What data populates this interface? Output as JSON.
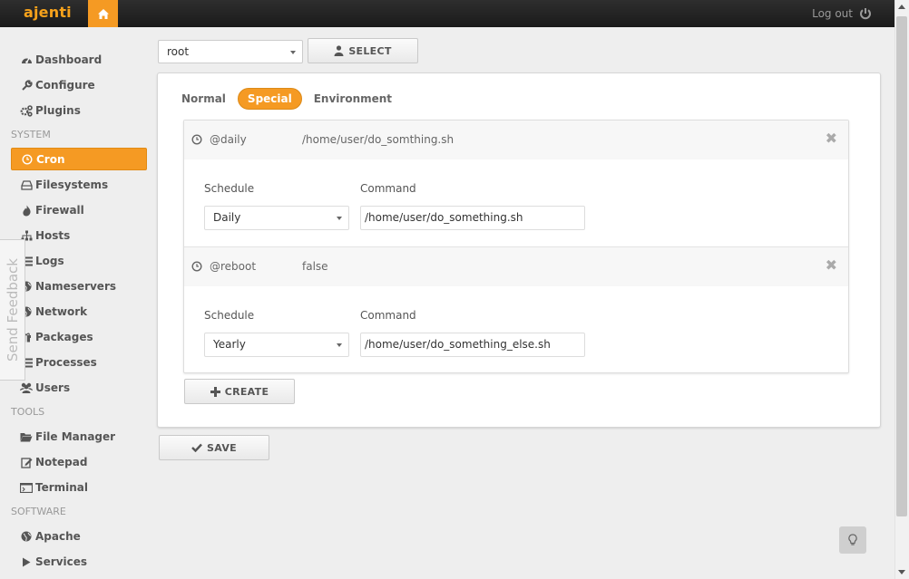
{
  "app": {
    "brand": "ajenti",
    "logout_label": "Log out"
  },
  "colors": {
    "accent": "#f59a23",
    "topbar": "#1f1f1f"
  },
  "sidebar": {
    "items_top": [
      {
        "label": "Dashboard",
        "icon": "dashboard-icon"
      },
      {
        "label": "Configure",
        "icon": "wrench-icon"
      },
      {
        "label": "Plugins",
        "icon": "cogs-icon"
      }
    ],
    "system_label": "SYSTEM",
    "items_system": [
      {
        "label": "Cron",
        "icon": "clock-icon",
        "active": true
      },
      {
        "label": "Filesystems",
        "icon": "hdd-icon"
      },
      {
        "label": "Firewall",
        "icon": "fire-icon"
      },
      {
        "label": "Hosts",
        "icon": "sitemap-icon"
      },
      {
        "label": "Logs",
        "icon": "list-icon"
      },
      {
        "label": "Nameservers",
        "icon": "globe-icon"
      },
      {
        "label": "Network",
        "icon": "globe-icon"
      },
      {
        "label": "Packages",
        "icon": "gift-icon"
      },
      {
        "label": "Processes",
        "icon": "list-icon"
      },
      {
        "label": "Users",
        "icon": "users-icon"
      }
    ],
    "tools_label": "TOOLS",
    "items_tools": [
      {
        "label": "File Manager",
        "icon": "folder-icon"
      },
      {
        "label": "Notepad",
        "icon": "edit-icon"
      },
      {
        "label": "Terminal",
        "icon": "terminal-icon"
      }
    ],
    "software_label": "SOFTWARE",
    "items_software": [
      {
        "label": "Apache",
        "icon": "globe-icon"
      },
      {
        "label": "Services",
        "icon": "play-icon"
      }
    ]
  },
  "feedback": {
    "label": "Send Feedback"
  },
  "user_select": {
    "value": "root",
    "button_label": "SELECT"
  },
  "tabs": [
    {
      "label": "Normal"
    },
    {
      "label": "Special",
      "active": true
    },
    {
      "label": "Environment"
    }
  ],
  "entries": [
    {
      "special": "@daily",
      "command": "/home/user/do_somthing.sh",
      "schedule_label": "Schedule",
      "command_label": "Command",
      "schedule_value": "Daily",
      "command_value": "/home/user/do_something.sh"
    },
    {
      "special": "@reboot",
      "command": "false",
      "schedule_label": "Schedule",
      "command_label": "Command",
      "schedule_value": "Yearly",
      "command_value": "/home/user/do_something_else.sh"
    }
  ],
  "buttons": {
    "create_label": "CREATE",
    "save_label": "SAVE"
  }
}
